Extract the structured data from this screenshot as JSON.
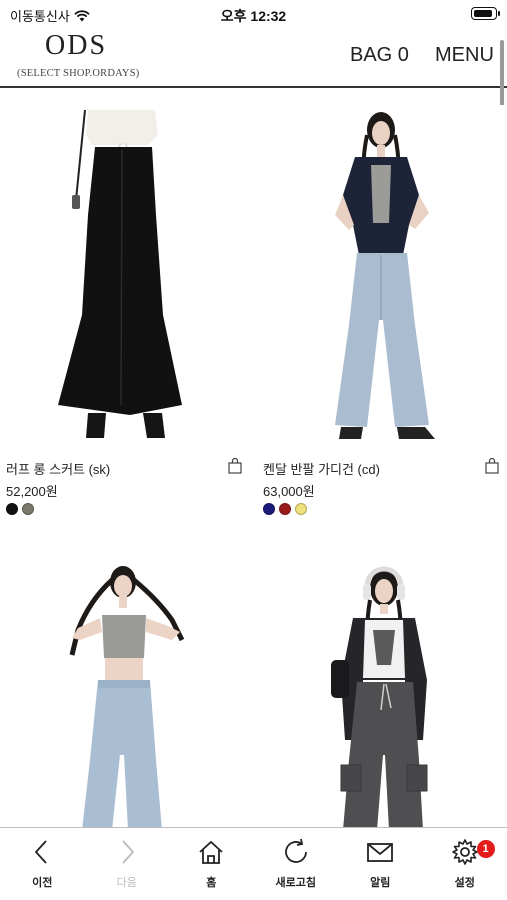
{
  "status_bar": {
    "carrier": "이동통신사",
    "time": "오후 12:32",
    "battery_level": 0.9
  },
  "header": {
    "logo": "ODS",
    "logo_subtitle": "(SELECT SHOP.ORDAYS)",
    "bag_label": "BAG 0",
    "menu_label": "MENU"
  },
  "products": [
    {
      "name": "러프 롱 스커트 (sk)",
      "price": "52,200원",
      "swatches": [
        "#111111",
        "#7a7868"
      ]
    },
    {
      "name": "켄달 반팔 가디건 (cd)",
      "price": "63,000원",
      "swatches": [
        "#1b1b7a",
        "#9b1b1b",
        "#efe07a"
      ]
    },
    {
      "name": "",
      "price": "",
      "swatches": []
    },
    {
      "name": "",
      "price": "",
      "swatches": []
    }
  ],
  "toolbar": {
    "items": [
      {
        "label": "이전",
        "icon": "chevron-left-icon"
      },
      {
        "label": "다음",
        "icon": "chevron-right-icon"
      },
      {
        "label": "홈",
        "icon": "home-icon"
      },
      {
        "label": "새로고침",
        "icon": "refresh-icon"
      },
      {
        "label": "알림",
        "icon": "mail-icon"
      },
      {
        "label": "설정",
        "icon": "gear-icon"
      }
    ],
    "settings_badge": "1"
  },
  "colors": {
    "badge": "#e41b1b",
    "header_rule": "#333333"
  }
}
